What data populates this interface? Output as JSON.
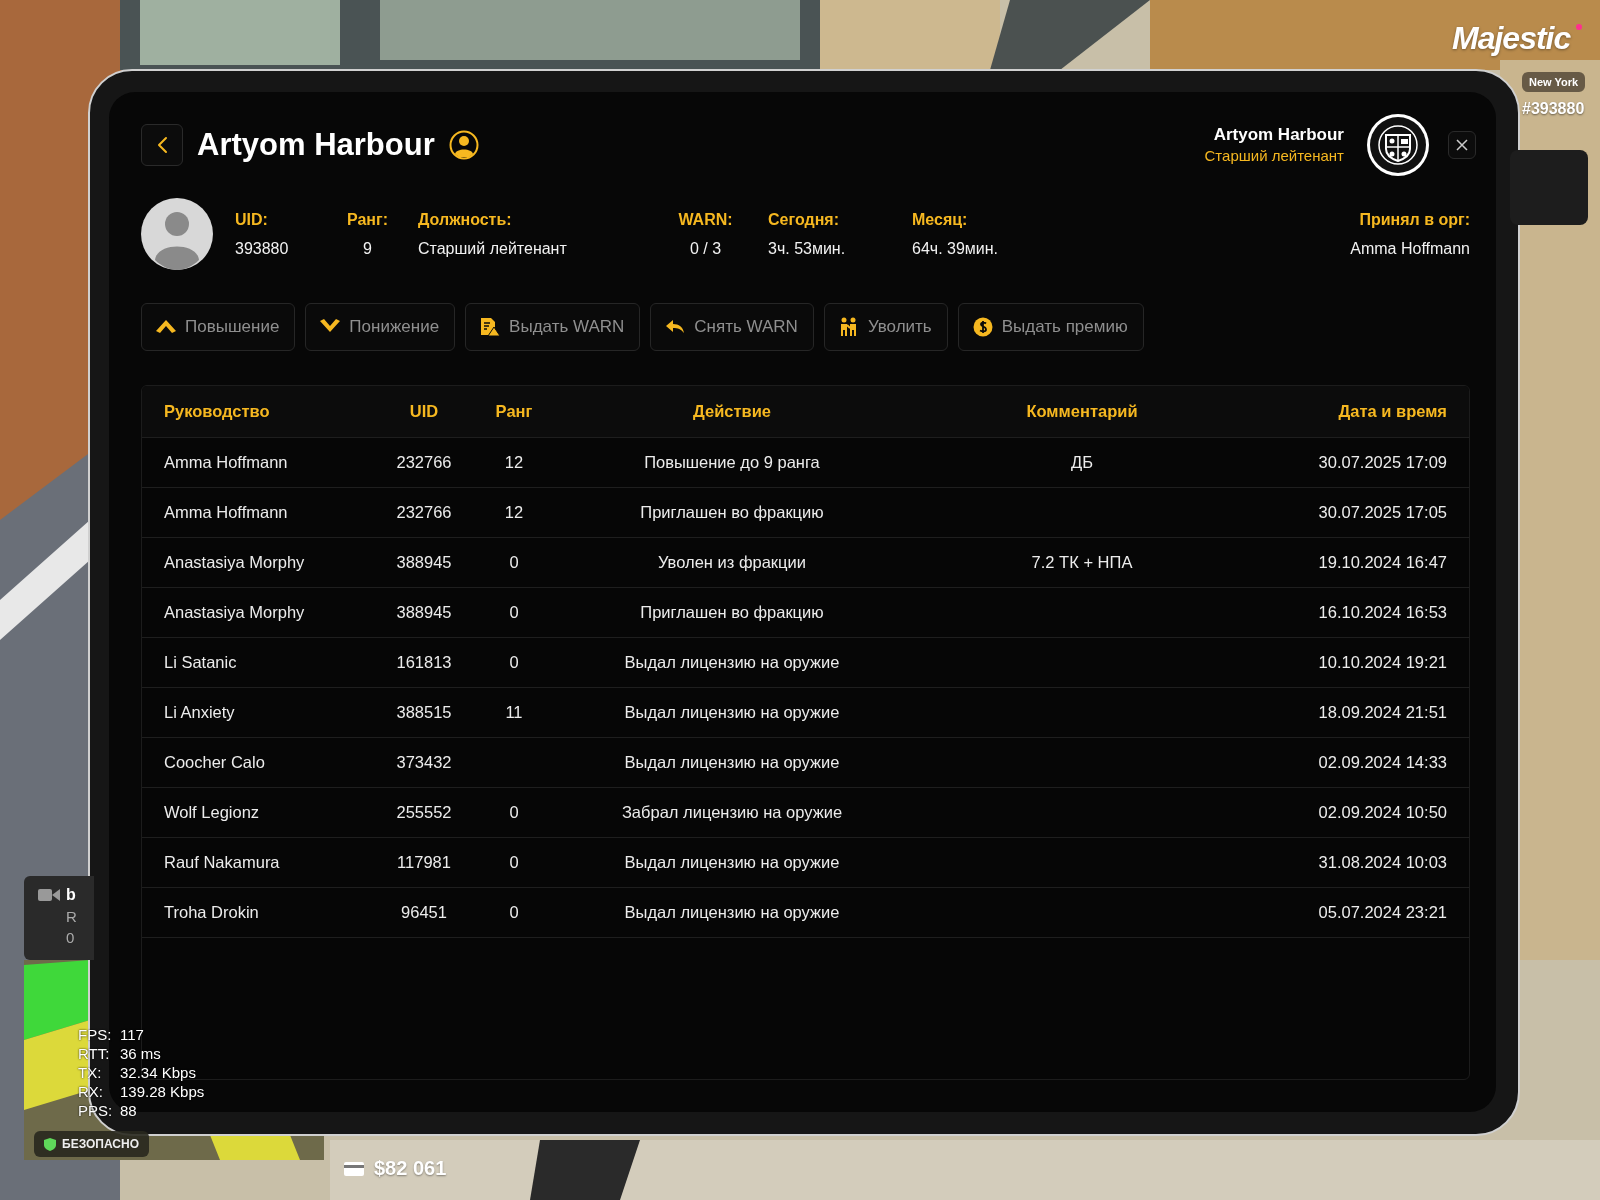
{
  "hud": {
    "logo": "Majestic",
    "server": "New York",
    "player_id": "#393880",
    "notification": {
      "title": "b",
      "lines": [
        "R",
        "0"
      ]
    },
    "zone": "БЕЗОПАСНО",
    "cash": "$82 061",
    "netstats": [
      {
        "label": "FPS:",
        "value": "117"
      },
      {
        "label": "RTT:",
        "value": "36 ms"
      },
      {
        "label": "TX:",
        "value": "32.34 Kbps"
      },
      {
        "label": "RX:",
        "value": "139.28 Kbps"
      },
      {
        "label": "PPS:",
        "value": "88"
      }
    ]
  },
  "profile": {
    "name": "Artyom Harbour",
    "viewer": {
      "name": "Artyom Harbour",
      "rank": "Старший лейтенант"
    },
    "stats": [
      {
        "label": "UID:",
        "value": "393880"
      },
      {
        "label": "Ранг:",
        "value": "9"
      },
      {
        "label": "Должность:",
        "value": "Старший лейтенант"
      },
      {
        "label": "WARN:",
        "value": "0 / 3"
      },
      {
        "label": "Сегодня:",
        "value": "3ч. 53мин."
      },
      {
        "label": "Месяц:",
        "value": "64ч. 39мин."
      },
      {
        "label": "Принял в орг:",
        "value": "Amma Hoffmann"
      }
    ],
    "actions": [
      "Повышение",
      "Понижение",
      "Выдать WARN",
      "Снять WARN",
      "Уволить",
      "Выдать премию"
    ]
  },
  "history": {
    "columns": [
      "Руководство",
      "UID",
      "Ранг",
      "Действие",
      "Комментарий",
      "Дата и время"
    ],
    "rows": [
      {
        "leader": "Amma Hoffmann",
        "uid": "232766",
        "rank": "12",
        "action": "Повышение до 9 ранга",
        "comment": "ДБ",
        "datetime": "30.07.2025 17:09"
      },
      {
        "leader": "Amma Hoffmann",
        "uid": "232766",
        "rank": "12",
        "action": "Приглашен во фракцию",
        "datetime": "30.07.2025 17:05"
      },
      {
        "leader": "Anastasiya Morphy",
        "uid": "388945",
        "rank": "0",
        "action": "Уволен из фракции",
        "comment": "7.2 ТК + НПА",
        "datetime": "19.10.2024 16:47"
      },
      {
        "leader": "Anastasiya Morphy",
        "uid": "388945",
        "rank": "0",
        "action": "Приглашен во фракцию",
        "datetime": "16.10.2024 16:53"
      },
      {
        "leader": "Li Satanic",
        "uid": "161813",
        "rank": "0",
        "action": "Выдал лицензию на оружие",
        "datetime": "10.10.2024 19:21"
      },
      {
        "leader": "Li Anxiety",
        "uid": "388515",
        "rank": "11",
        "action": "Выдал лицензию на оружие",
        "datetime": "18.09.2024 21:51"
      },
      {
        "leader": "Coocher Calo",
        "uid": "373432",
        "action": "Выдал лицензию на оружие",
        "datetime": "02.09.2024 14:33"
      },
      {
        "leader": "Wolf Legionz",
        "uid": "255552",
        "rank": "0",
        "action": "Забрал лицензию на оружие",
        "datetime": "02.09.2024 10:50"
      },
      {
        "leader": "Rauf Nakamura",
        "uid": "117981",
        "rank": "0",
        "action": "Выдал лицензию на оружие",
        "datetime": "31.08.2024 10:03"
      },
      {
        "leader": "Troha Drokin",
        "uid": "96451",
        "rank": "0",
        "action": "Выдал лицензию на оружие",
        "datetime": "05.07.2024 23:21"
      }
    ]
  }
}
